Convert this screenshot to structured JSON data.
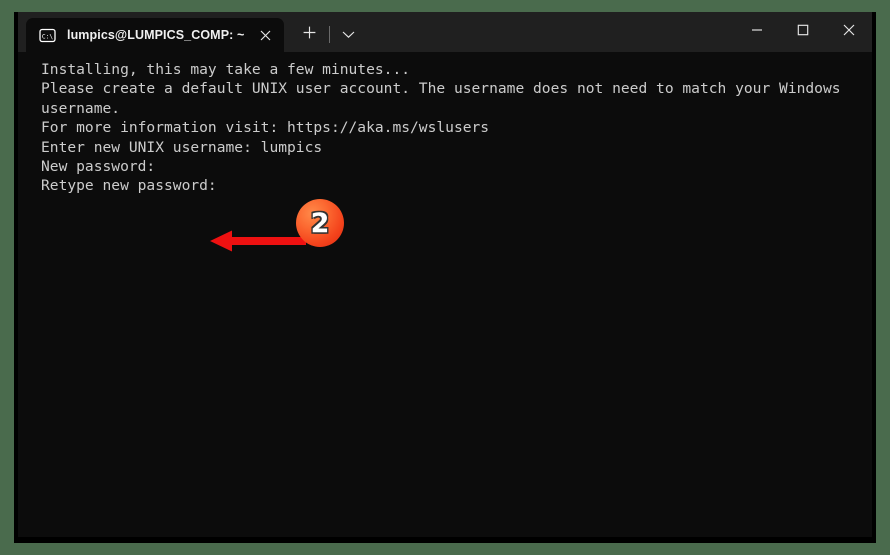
{
  "window": {
    "background_color": "#4a6b4d",
    "chrome_color": "#202020",
    "terminal_background": "#0c0c0c",
    "terminal_foreground": "#cccccc"
  },
  "titlebar": {
    "tab": {
      "icon": "command-prompt-icon",
      "icon_label": "C:\\",
      "title": "lumpics@LUMPICS_COMP: ~",
      "close_icon": "close-icon"
    },
    "new_tab_icon": "plus-icon",
    "dropdown_icon": "chevron-down-icon",
    "controls": {
      "minimize_icon": "minimize-icon",
      "maximize_icon": "maximize-icon",
      "close_icon": "close-icon"
    }
  },
  "terminal": {
    "lines": [
      "Installing, this may take a few minutes...",
      "Please create a default UNIX user account. The username does not need to match your Windows",
      "username.",
      "For more information visit: https://aka.ms/wslusers",
      "Enter new UNIX username: lumpics",
      "New password:",
      "Retype new password: "
    ]
  },
  "annotations": {
    "arrow": {
      "icon": "left-arrow-icon",
      "color": "#ee1111",
      "direction": "left"
    },
    "badge": {
      "label": "2",
      "color_start": "#ff8a4a",
      "color_end": "#e02810"
    }
  }
}
